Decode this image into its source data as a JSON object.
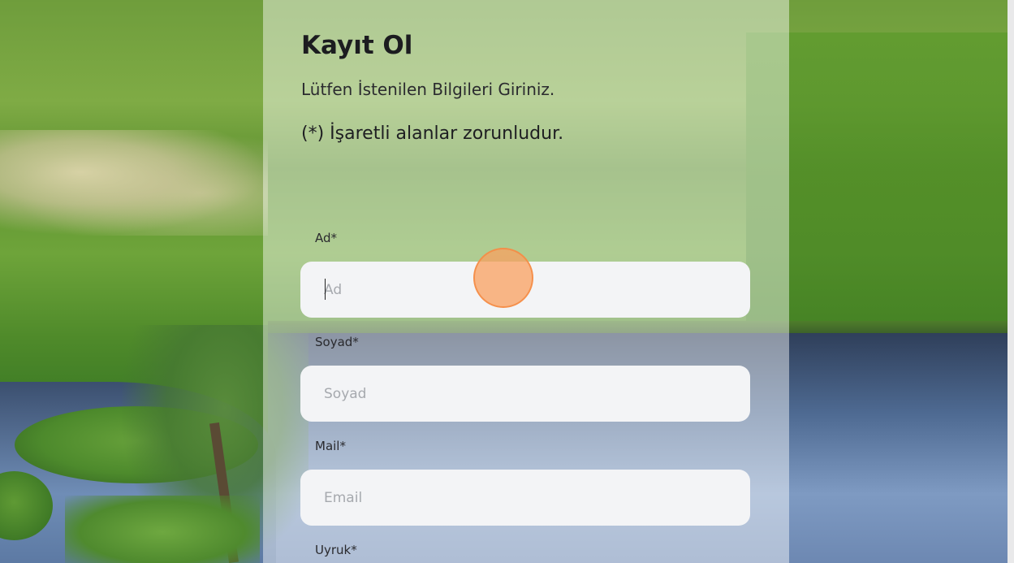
{
  "form": {
    "title": "Kayıt Ol",
    "subtitle": "Lütfen İstenilen Bilgileri Giriniz.",
    "required_note": "(*) İşaretli alanlar zorunludur.",
    "fields": [
      {
        "label": "Ad*",
        "placeholder": "Ad",
        "value": ""
      },
      {
        "label": "Soyad*",
        "placeholder": "Soyad",
        "value": ""
      },
      {
        "label": "Mail*",
        "placeholder": "Email",
        "value": ""
      },
      {
        "label": "Uyruk*"
      }
    ]
  },
  "colors": {
    "panel_overlay": "rgba(255,255,255,0.45)",
    "input_bg": "#f3f4f6",
    "title_text": "#1c1c20",
    "click_marker": "#f9a05f"
  }
}
